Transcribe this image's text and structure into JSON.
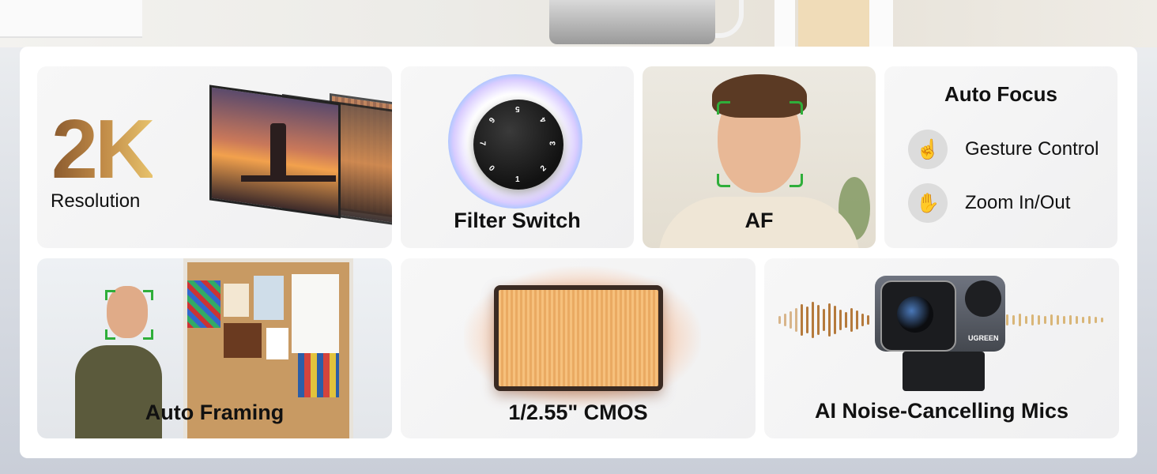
{
  "cards": {
    "resolution": {
      "big": "2K",
      "caption": "Resolution"
    },
    "filter": {
      "label": "Filter Switch",
      "dial_numbers": [
        "5",
        "4",
        "3",
        "2",
        "1",
        "0",
        "7",
        "6"
      ]
    },
    "af": {
      "label": "AF"
    },
    "auto_focus": {
      "title": "Auto Focus",
      "items": [
        {
          "label": "Gesture Control",
          "icon": "pointing-hand-icon"
        },
        {
          "label": "Zoom In/Out",
          "icon": "open-hand-icon"
        }
      ]
    },
    "framing": {
      "label": "Auto Framing"
    },
    "cmos": {
      "label": "1/2.55\" CMOS"
    },
    "mics": {
      "label": "AI Noise-Cancelling Mics",
      "brand": "UGREEN"
    }
  },
  "colors": {
    "gold_start": "#8a5a2e",
    "gold_end": "#e7c26b",
    "focus_bracket": "#2fae3a",
    "panel_bg": "#ffffff"
  }
}
